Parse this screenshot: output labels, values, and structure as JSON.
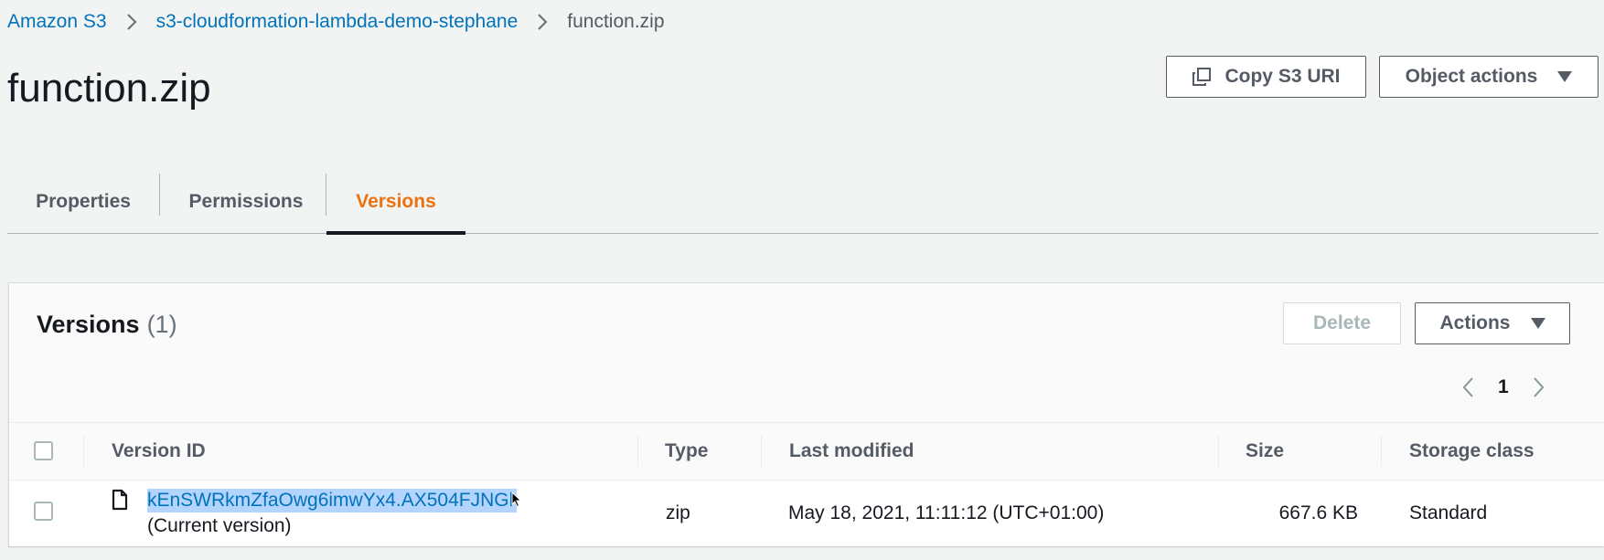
{
  "breadcrumb": {
    "items": [
      {
        "label": "Amazon S3"
      },
      {
        "label": "s3-cloudformation-lambda-demo-stephane"
      },
      {
        "label": "function.zip"
      }
    ],
    "separator_icon": "chevron-right-icon"
  },
  "header": {
    "title": "function.zip",
    "copy_uri_label": "Copy S3 URI",
    "copy_icon": "copy-icon",
    "object_actions_label": "Object actions"
  },
  "tabs": [
    {
      "label": "Properties",
      "active": false
    },
    {
      "label": "Permissions",
      "active": false
    },
    {
      "label": "Versions",
      "active": true
    }
  ],
  "versions_panel": {
    "title": "Versions",
    "count": "(1)",
    "delete_label": "Delete",
    "delete_disabled": true,
    "actions_label": "Actions",
    "pagination": {
      "current_page": "1"
    }
  },
  "table": {
    "columns": [
      "Version ID",
      "Type",
      "Last modified",
      "Size",
      "Storage class"
    ],
    "rows": [
      {
        "version_id": "kEnSWRkmZfaOwg6imwYx4.AX504FJNGl",
        "version_note": "(Current version)",
        "type": "zip",
        "last_modified": "May 18, 2021, 11:11:12 (UTC+01:00)",
        "size": "667.6 KB",
        "storage_class": "Standard"
      }
    ]
  },
  "colors": {
    "link": "#0073bb",
    "active_tab": "#ec7211",
    "selection_highlight": "#b3d4fc",
    "background": "#f2f3f3"
  }
}
